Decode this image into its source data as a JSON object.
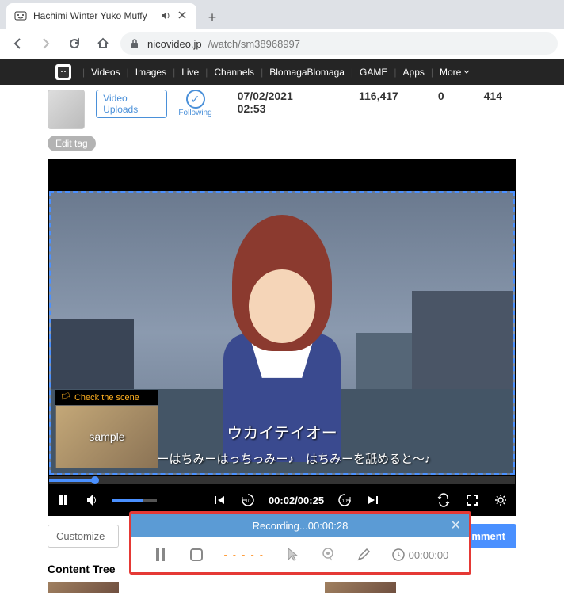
{
  "browser": {
    "tab_title": "Hachimi Winter Yuko Muffy",
    "url_host": "nicovideo.jp",
    "url_path": "/watch/sm38968997"
  },
  "site_nav": {
    "items": [
      "Videos",
      "Images",
      "Live",
      "Channels",
      "BlomagaBlomaga",
      "GAME",
      "Apps"
    ],
    "more": "More"
  },
  "info": {
    "upload_button": "Video Uploads",
    "following": "Following",
    "date": "07/02/2021 02:53",
    "views": "116,417",
    "comments": "0",
    "mylist": "414"
  },
  "tags": {
    "edit": "Edit tag"
  },
  "scene_popup": {
    "header": "Check the scene",
    "sample": "sample"
  },
  "subtitles": {
    "line1": "ウカイテイオー",
    "line2": "ちみーはちみーはっちっみー♪　はちみーを舐めると〜♪"
  },
  "player": {
    "time": "00:02/00:25"
  },
  "comment_row": {
    "customize": "Customize",
    "comment": "Comment"
  },
  "content_tree": {
    "title": "Content Tree"
  },
  "recorder": {
    "status_prefix": "Recording... ",
    "elapsed": "00:00:28",
    "clock": "00:00:00"
  }
}
